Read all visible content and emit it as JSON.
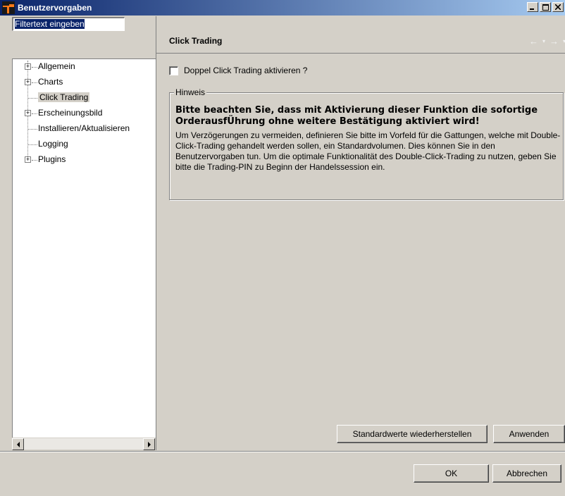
{
  "window": {
    "title": "Benutzervorgaben"
  },
  "filter": {
    "value": "Filtertext eingeben"
  },
  "tree": {
    "items": [
      {
        "label": "Allgemein",
        "expandable": true
      },
      {
        "label": "Charts",
        "expandable": true
      },
      {
        "label": "Click Trading",
        "expandable": false,
        "selected": true
      },
      {
        "label": "Erscheinungsbild",
        "expandable": true
      },
      {
        "label": "Installieren/Aktualisieren",
        "expandable": false
      },
      {
        "label": "Logging",
        "expandable": false
      },
      {
        "label": "Plugins",
        "expandable": true
      }
    ]
  },
  "panel": {
    "title": "Click Trading",
    "checkbox_label": "Doppel Click Trading aktivieren ?",
    "checkbox_checked": false,
    "group_legend": "Hinweis",
    "note_bold": "Bitte beachten Sie, dass mit Aktivierung dieser Funktion die sofortige OrderausfÜhrung ohne weitere Bestätigung aktiviert wird!",
    "note_text": "Um Verzögerungen zu vermeiden, definieren Sie bitte im Vorfeld für die Gattungen, welche mit Double-Click-Trading gehandelt werden sollen, ein Standardvolumen. Dies können Sie in den Benutzervorgaben tun. Um die optimale Funktionalität des Double-Click-Trading zu nutzen, geben Sie bitte die Trading-PIN zu Beginn der Handelssession ein.",
    "restore_label": "Standardwerte wiederherstellen",
    "apply_label": "Anwenden"
  },
  "footer": {
    "ok_label": "OK",
    "cancel_label": "Abbrechen"
  }
}
